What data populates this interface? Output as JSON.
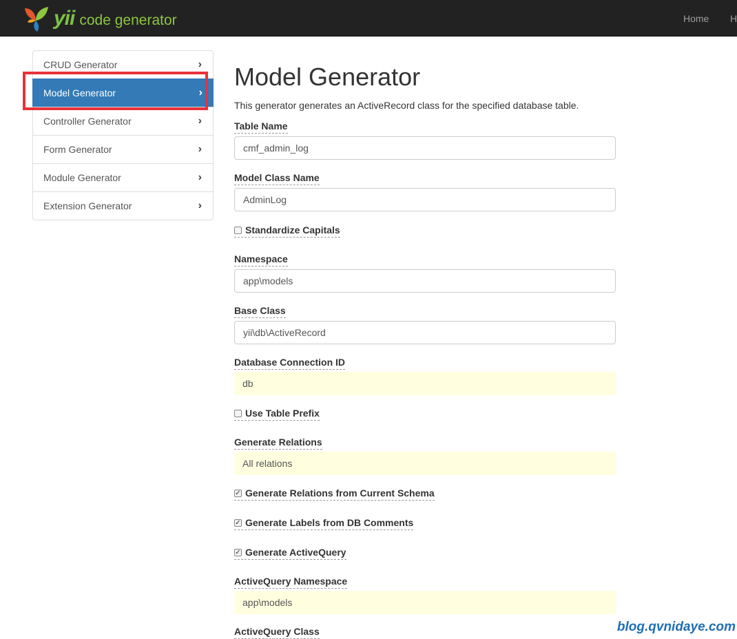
{
  "navbar": {
    "brand_yii": "yii",
    "brand_code_generator": "code generator",
    "links": [
      "Home",
      "H"
    ]
  },
  "sidebar": {
    "items": [
      {
        "label": "CRUD Generator",
        "active": false
      },
      {
        "label": "Model Generator",
        "active": true
      },
      {
        "label": "Controller Generator",
        "active": false
      },
      {
        "label": "Form Generator",
        "active": false
      },
      {
        "label": "Module Generator",
        "active": false
      },
      {
        "label": "Extension Generator",
        "active": false
      }
    ],
    "chevron": "›"
  },
  "main": {
    "title": "Model Generator",
    "description": "This generator generates an ActiveRecord class for the specified database table.",
    "fields": {
      "table_name": {
        "label": "Table Name",
        "value": "cmf_admin_log"
      },
      "model_class_name": {
        "label": "Model Class Name",
        "value": "AdminLog"
      },
      "standardize_capitals": {
        "label": "Standardize Capitals",
        "checked": false
      },
      "namespace": {
        "label": "Namespace",
        "value": "app\\models"
      },
      "base_class": {
        "label": "Base Class",
        "value": "yii\\db\\ActiveRecord"
      },
      "db_connection_id": {
        "label": "Database Connection ID",
        "value": "db"
      },
      "use_table_prefix": {
        "label": "Use Table Prefix",
        "checked": false
      },
      "generate_relations": {
        "label": "Generate Relations",
        "value": "All relations"
      },
      "relations_from_schema": {
        "label": "Generate Relations from Current Schema",
        "checked": true
      },
      "labels_from_db": {
        "label": "Generate Labels from DB Comments",
        "checked": true
      },
      "generate_activequery": {
        "label": "Generate ActiveQuery",
        "checked": true
      },
      "activequery_namespace": {
        "label": "ActiveQuery Namespace",
        "value": "app\\models"
      },
      "activequery_class": {
        "label": "ActiveQuery Class"
      }
    }
  },
  "watermark": "blog.qvnidaye.com",
  "colors": {
    "navbar": "#222222",
    "active_item": "#337ab7",
    "highlight_box": "#e8323b",
    "sticky_input": "#ffffe0",
    "watermark": "#1f6fb5"
  }
}
